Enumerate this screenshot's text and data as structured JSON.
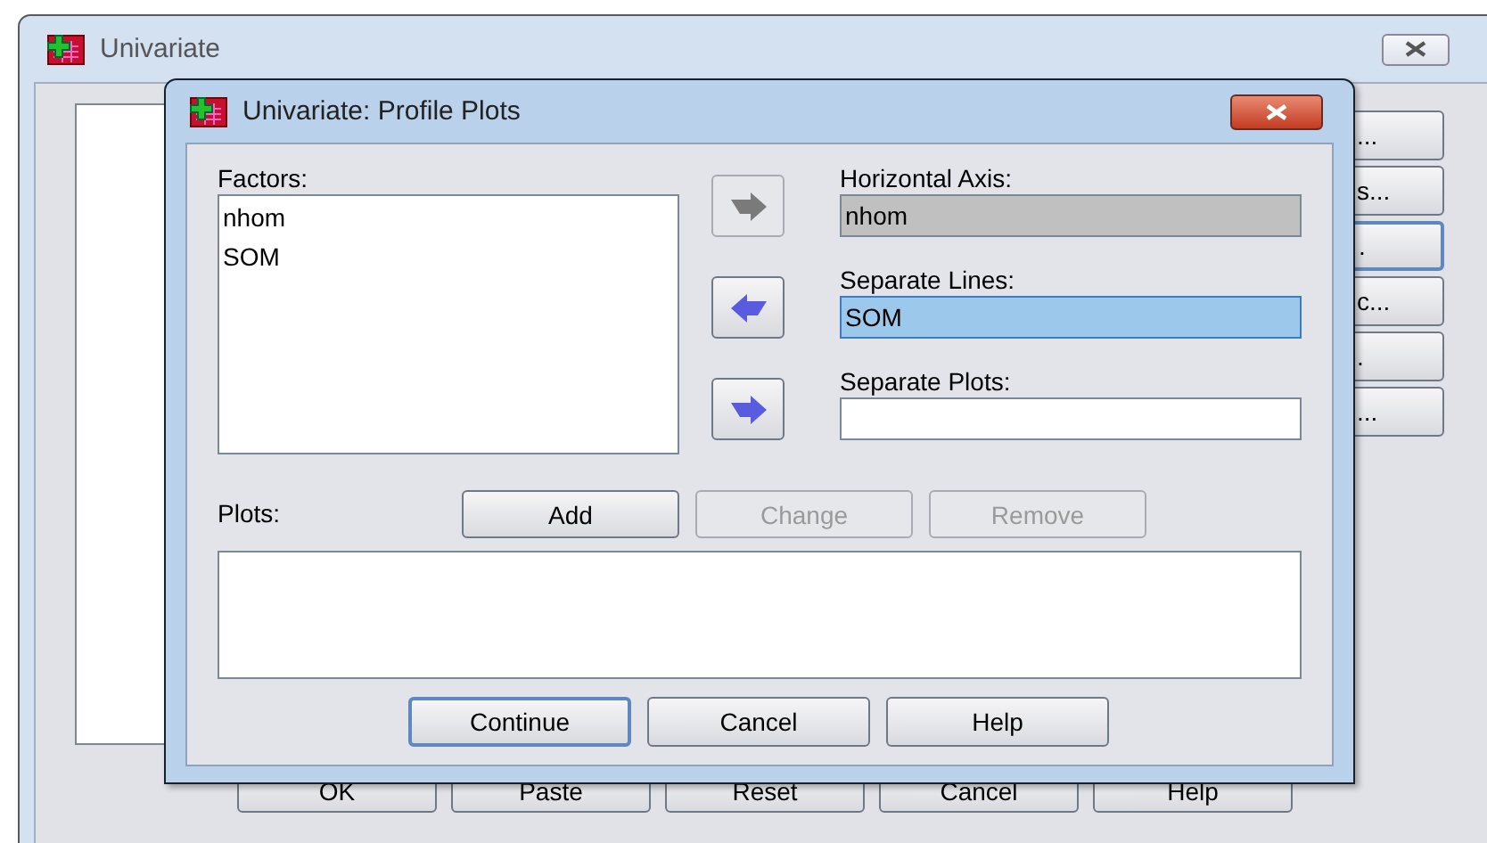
{
  "main_window": {
    "title": "Univariate",
    "side_buttons": [
      {
        "label": "...",
        "focused": false
      },
      {
        "label": "s...",
        "focused": false
      },
      {
        "label": ".",
        "focused": true
      },
      {
        "label": "c...",
        "focused": false
      },
      {
        "label": ".",
        "focused": false
      },
      {
        "label": "...",
        "focused": false
      }
    ],
    "buttons": [
      {
        "label": "OK"
      },
      {
        "label": "Paste"
      },
      {
        "label": "Reset"
      },
      {
        "label": "Cancel"
      },
      {
        "label": "Help"
      }
    ]
  },
  "dialog": {
    "title": "Univariate: Profile Plots",
    "factors": {
      "label": "Factors:",
      "items": [
        "nhom",
        "SOM"
      ]
    },
    "targets": [
      {
        "label": "Horizontal Axis:",
        "value": "nhom",
        "kind": "right",
        "arrow_disabled": true,
        "disabled": true,
        "selected": false
      },
      {
        "label": "Separate Lines:",
        "value": "SOM",
        "kind": "left",
        "arrow_disabled": false,
        "disabled": false,
        "selected": true
      },
      {
        "label": "Separate Plots:",
        "kind": "right",
        "arrow_disabled": false,
        "disabled": false,
        "selected": false
      }
    ],
    "plots": {
      "label": "Plots:",
      "buttons": [
        {
          "label": "Add",
          "disabled": false
        },
        {
          "label": "Change",
          "disabled": true
        },
        {
          "label": "Remove",
          "disabled": true
        }
      ]
    },
    "buttons": [
      {
        "label": "Continue",
        "focused": true
      },
      {
        "label": "Cancel",
        "focused": false
      },
      {
        "label": "Help",
        "focused": false
      }
    ]
  }
}
